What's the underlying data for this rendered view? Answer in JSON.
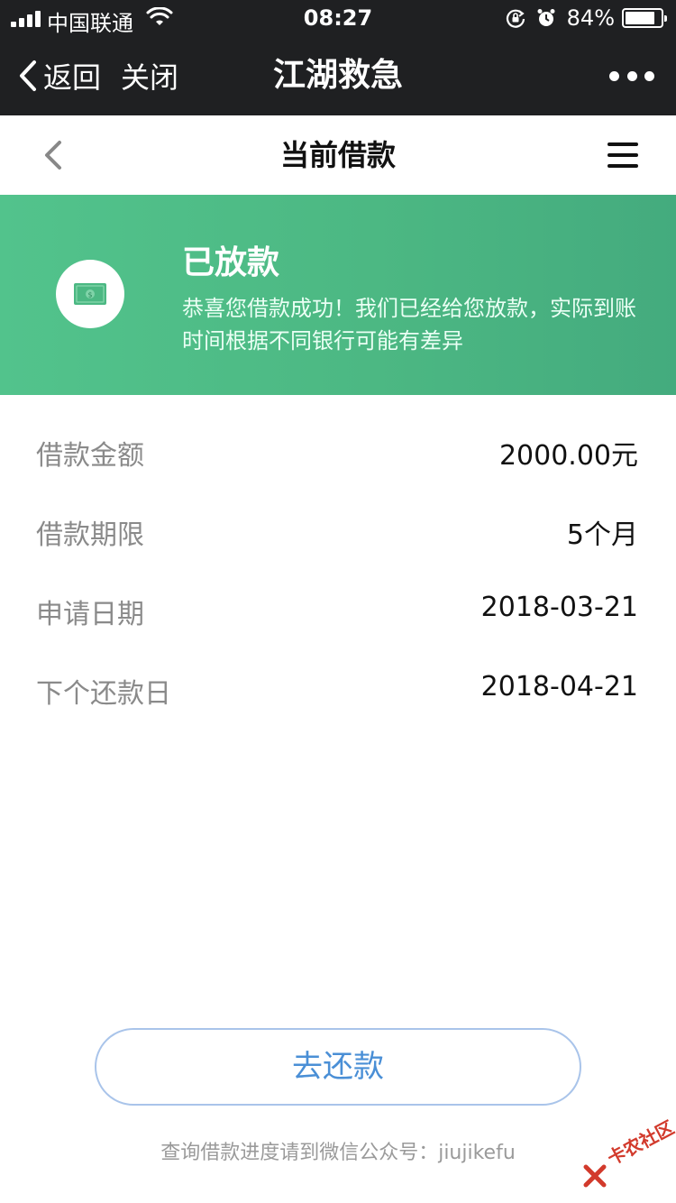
{
  "status_bar": {
    "carrier": "中国联通",
    "time": "08:27",
    "battery_pct": "84%",
    "battery_level": 0.84
  },
  "wechat_nav": {
    "back_label": "返回",
    "close_label": "关闭",
    "title": "江湖救急"
  },
  "page_header": {
    "title": "当前借款"
  },
  "banner": {
    "title": "已放款",
    "description": "恭喜您借款成功！我们已经给您放款，实际到账时间根据不同银行可能有差异"
  },
  "loan_details": [
    {
      "label": "借款金额",
      "value": "2000.00元"
    },
    {
      "label": "借款期限",
      "value": "5个月"
    },
    {
      "label": "申请日期",
      "value": "2018-03-21"
    },
    {
      "label": "下个还款日",
      "value": "2018-04-21"
    }
  ],
  "repay_button": {
    "label": "去还款"
  },
  "footnote": "查询借款进度请到微信公众号：jiujikefu",
  "watermark": "卡农社区",
  "colors": {
    "banner_green": "#4cb883",
    "button_text_blue": "#4a8fd6",
    "nav_dark": "#1f2022"
  }
}
